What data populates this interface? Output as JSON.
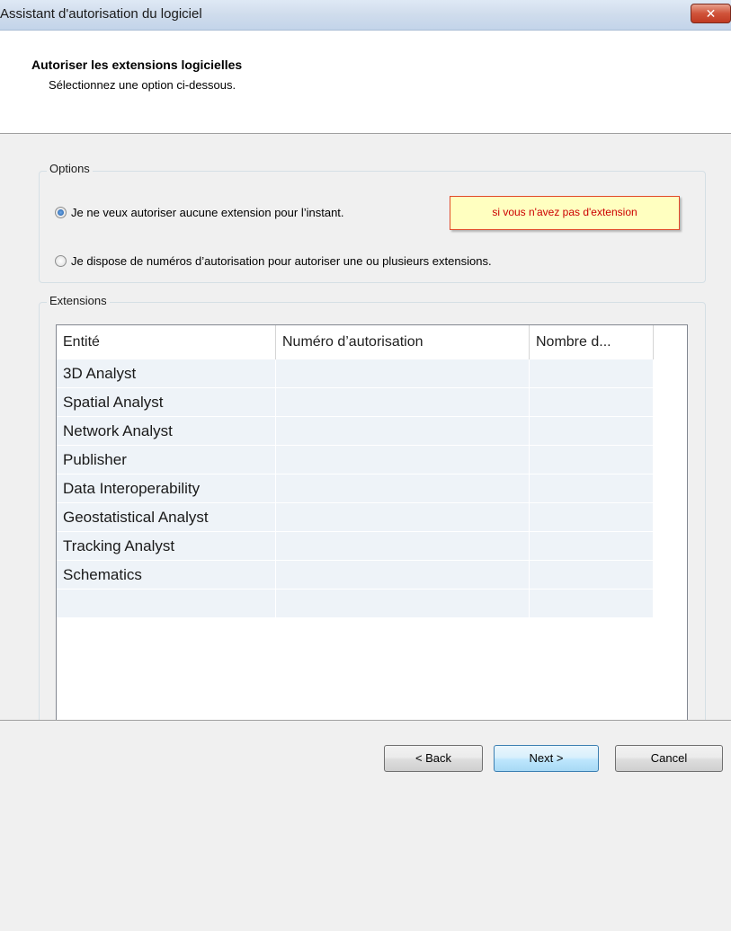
{
  "window": {
    "title": "Assistant d'autorisation du logiciel",
    "close_glyph": "✕"
  },
  "header": {
    "title": "Autoriser les extensions logicielles",
    "subtitle": "Sélectionnez une option ci-dessous."
  },
  "options": {
    "group_label": "Options",
    "option1_label": "Je ne veux autoriser aucune extension pour l’instant.",
    "option1_selected": true,
    "option2_label": "Je dispose de numéros d’autorisation pour autoriser une ou plusieurs extensions.",
    "option2_selected": false
  },
  "tooltip": {
    "text": "si vous n'avez pas d'extension"
  },
  "extensions": {
    "group_label": "Extensions",
    "columns": [
      "Entité",
      "Numéro d’autorisation",
      "Nombre d..."
    ],
    "rows": [
      {
        "entity": "3D Analyst",
        "number": "",
        "count": ""
      },
      {
        "entity": "Spatial Analyst",
        "number": "",
        "count": ""
      },
      {
        "entity": "Network Analyst",
        "number": "",
        "count": ""
      },
      {
        "entity": "Publisher",
        "number": "",
        "count": ""
      },
      {
        "entity": "Data Interoperability",
        "number": "",
        "count": ""
      },
      {
        "entity": "Geostatistical Analyst",
        "number": "",
        "count": ""
      },
      {
        "entity": "Tracking Analyst",
        "number": "",
        "count": ""
      },
      {
        "entity": "Schematics",
        "number": "",
        "count": ""
      },
      {
        "entity": "",
        "number": "",
        "count": ""
      }
    ]
  },
  "footer": {
    "back_label": "< Back",
    "next_label": "Next >",
    "cancel_label": "Cancel"
  }
}
